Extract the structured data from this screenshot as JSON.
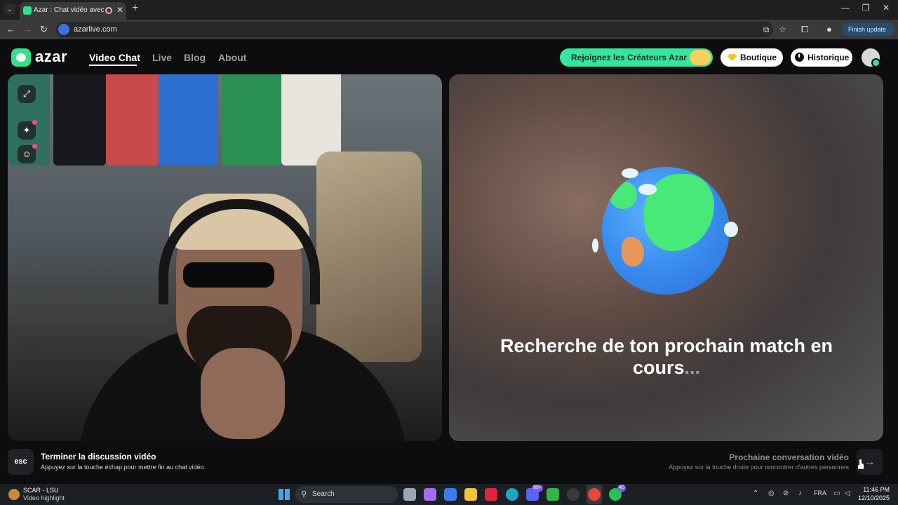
{
  "browser": {
    "tab_title": "Azar : Chat vidéo avec de n",
    "tab_close": "✕",
    "new_tab": "+",
    "url": "azarlive.com",
    "finish_update": "Finish update"
  },
  "header": {
    "logo": "azar",
    "nav": [
      "Video Chat",
      "Live",
      "Blog",
      "About"
    ],
    "creators_button": "Rejoignez les Créateurs Azar",
    "shop_button": "Boutique",
    "history_button": "Historique"
  },
  "right_panel": {
    "search_title": "Recherche de ton prochain match en cours",
    "dots": "..."
  },
  "bottom": {
    "esc_key": "esc",
    "end_title": "Terminer la discussion vidéo",
    "end_hint": "Appuyez sur la touche échap pour mettre fin au chat vidéo.",
    "next_title": "Prochaine conversation vidéo",
    "next_hint": "Appuyez sur la touche droite pour rencontrer d'autres personnes",
    "next_arrow": "→"
  },
  "taskbar": {
    "widget_title": "SCAR - LSU",
    "widget_sub": "Video highlight",
    "search_placeholder": "Search",
    "discord_badge": "99+",
    "whatsapp_badge": "40",
    "language": "FRA",
    "time": "11:46 PM",
    "date": "12/10/2025"
  },
  "icons": {
    "tab_favicon": "azar-favicon",
    "globe": "globe-illustration",
    "expand": "expand-icon",
    "sparkle": "sparkle-effects-icon",
    "emoji": "emoji-mask-icon"
  },
  "colors": {
    "brand_green": "#34e08b",
    "creators_button": "#35e6a0",
    "shop_gem": "#f5c530",
    "notification_dot": "#ff4b6e"
  }
}
